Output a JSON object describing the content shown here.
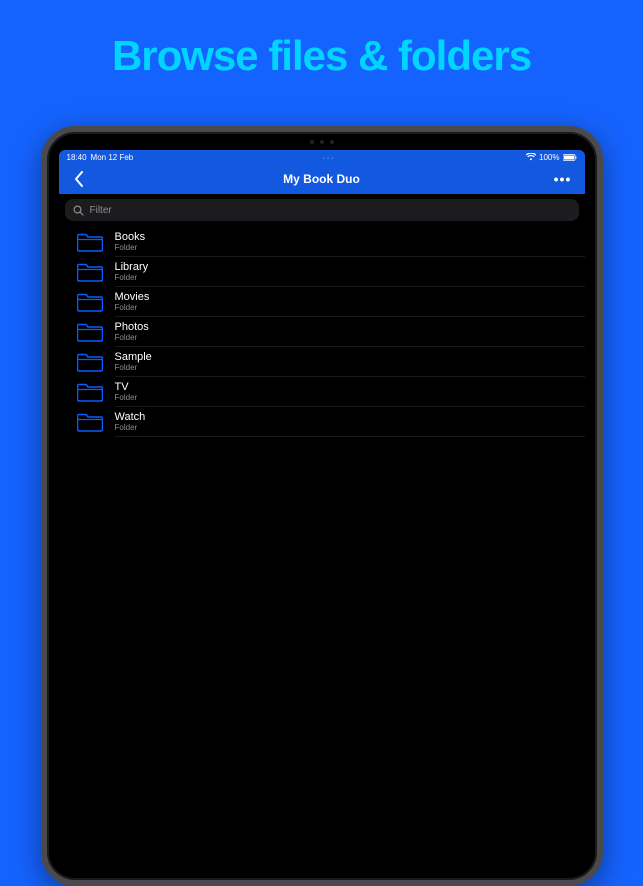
{
  "marketing": {
    "headline": "Browse files & folders"
  },
  "statusbar": {
    "time": "18:40",
    "date": "Mon 12 Feb",
    "battery_percent": "100%"
  },
  "navbar": {
    "title": "My Book Duo"
  },
  "filter": {
    "placeholder": "Filter"
  },
  "folders": [
    {
      "name": "Books",
      "kind": "Folder"
    },
    {
      "name": "Library",
      "kind": "Folder"
    },
    {
      "name": "Movies",
      "kind": "Folder"
    },
    {
      "name": "Photos",
      "kind": "Folder"
    },
    {
      "name": "Sample",
      "kind": "Folder"
    },
    {
      "name": "TV",
      "kind": "Folder"
    },
    {
      "name": "Watch",
      "kind": "Folder"
    }
  ]
}
